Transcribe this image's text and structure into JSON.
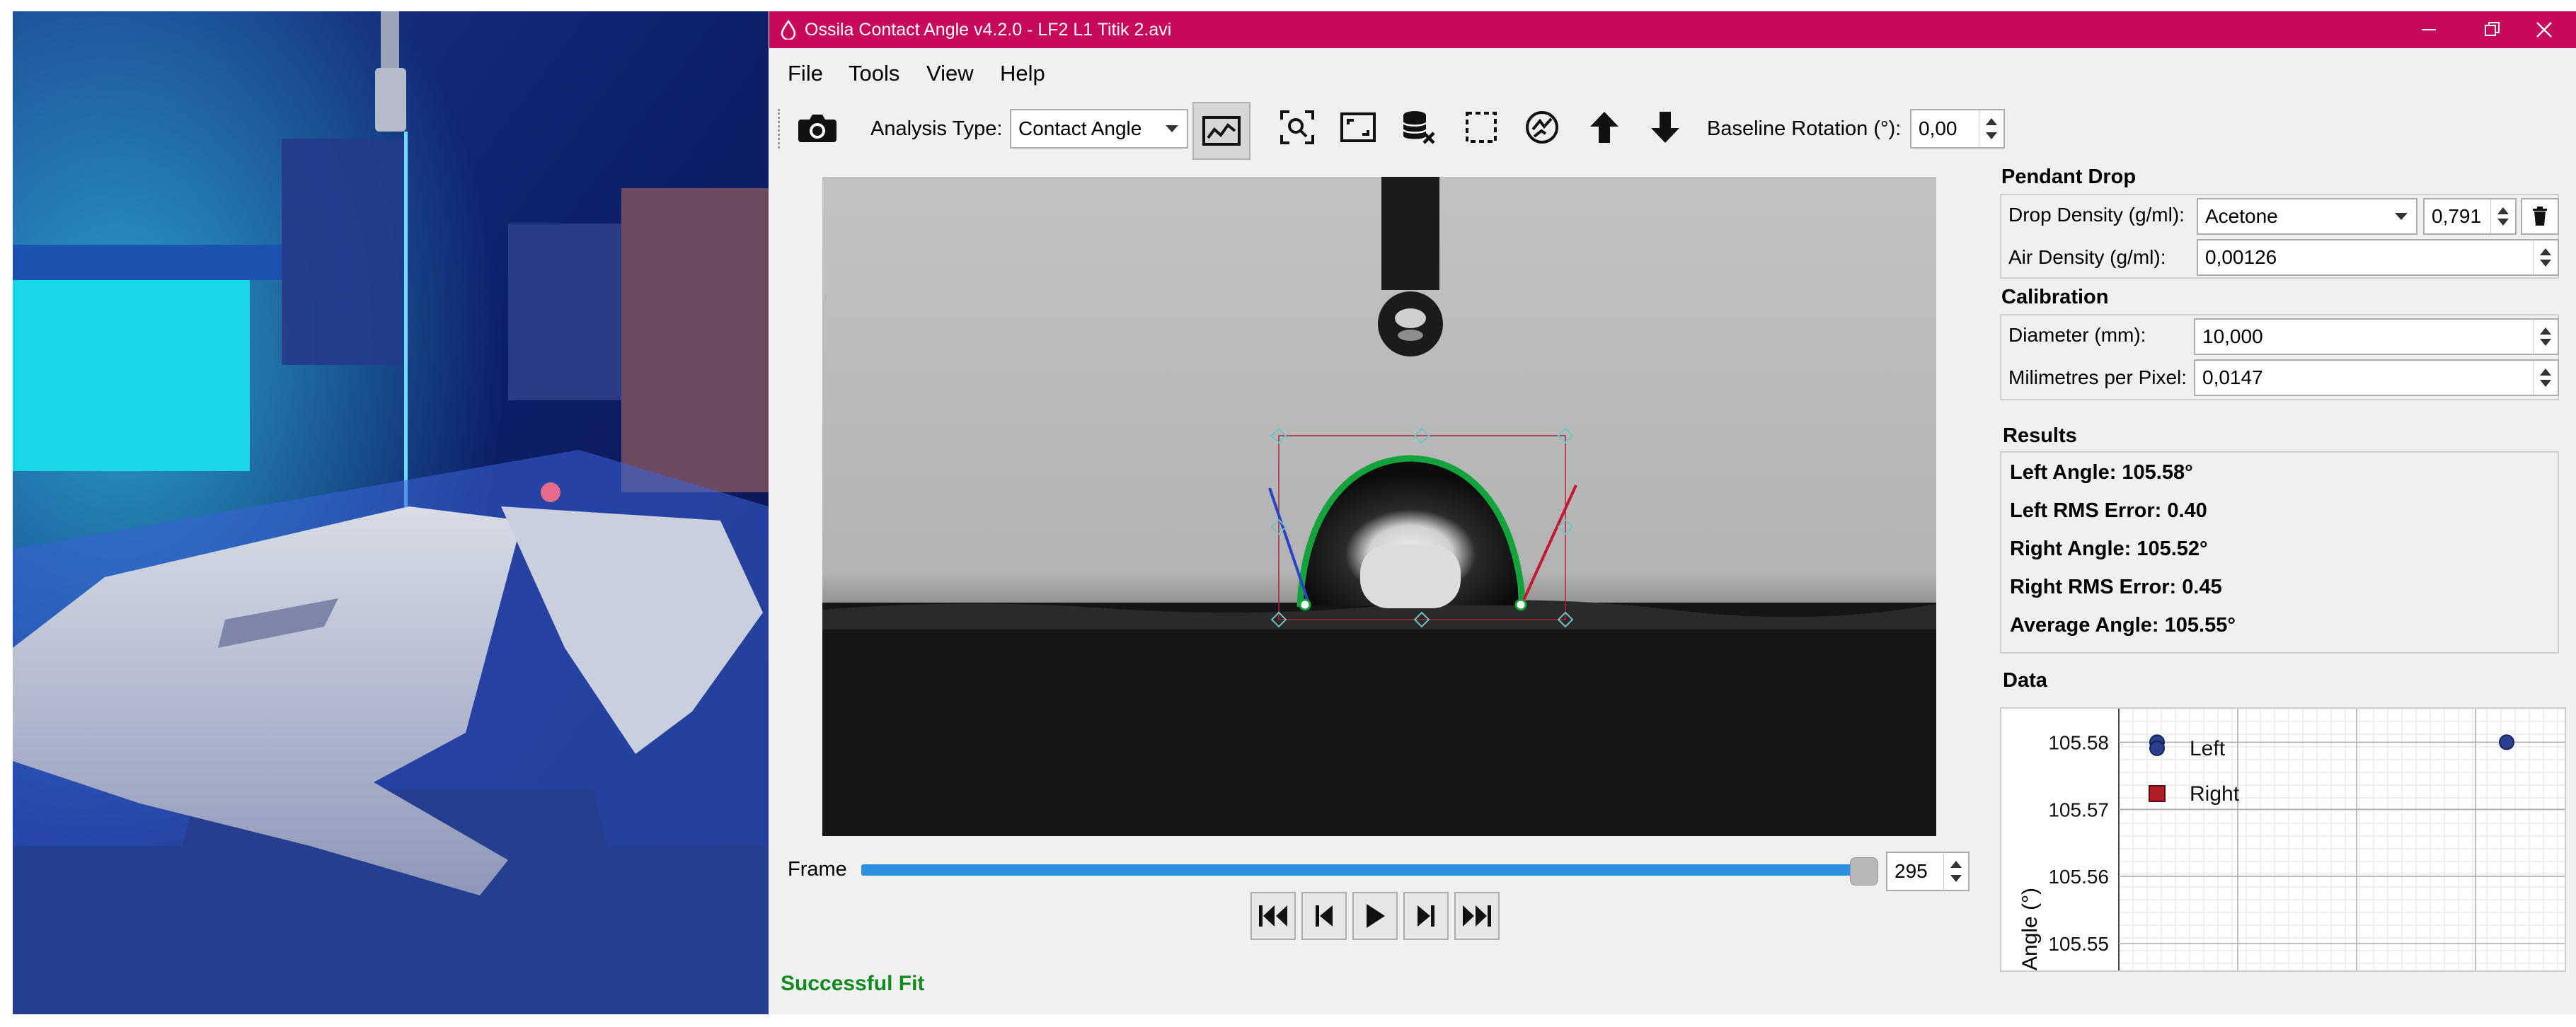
{
  "window": {
    "title": "Ossila Contact Angle v4.2.0 - LF2 L1 Titik 2.avi",
    "accent_color": "#c8085a",
    "controls": [
      "minimize-icon",
      "restore-icon",
      "close-icon"
    ]
  },
  "menu": [
    "File",
    "Tools",
    "View",
    "Help"
  ],
  "toolbar": {
    "analysis_type_label": "Analysis Type:",
    "analysis_type_value": "Contact Angle",
    "baseline_rotation_label": "Baseline Rotation (°):",
    "baseline_rotation_value": "0,00",
    "icons": [
      "camera-icon",
      "fit-line-icon",
      "zoom-search-icon",
      "crop-frame-icon",
      "clear-data-icon",
      "select-region-icon",
      "auto-fit-icon",
      "arrow-up-icon",
      "arrow-down-icon"
    ]
  },
  "playback": {
    "frame_label": "Frame",
    "frame_value": "295",
    "slider_fraction": 1.0,
    "buttons": [
      "skip-to-start-icon",
      "step-back-icon",
      "play-icon",
      "step-forward-icon",
      "skip-to-end-icon"
    ]
  },
  "status": "Successful Fit",
  "pendant_drop": {
    "title": "Pendant Drop",
    "drop_density_label": "Drop Density (g/ml):",
    "liquid": "Acetone",
    "drop_density_value": "0,791",
    "air_density_label": "Air Density (g/ml):",
    "air_density_value": "0,00126"
  },
  "calibration": {
    "title": "Calibration",
    "diameter_label": "Diameter (mm):",
    "diameter_value": "10,000",
    "mpp_label": "Milimetres per Pixel:",
    "mpp_value": "0,0147"
  },
  "results": {
    "title": "Results",
    "lines": [
      "Left Angle: 105.58°",
      "Left RMS Error: 0.40",
      "Right Angle: 105.52°",
      "Right RMS Error: 0.45",
      "Average Angle: 105.55°"
    ]
  },
  "data_section": {
    "title": "Data",
    "chart_data": {
      "type": "scatter",
      "ylabel": "Angle (°)",
      "yticks": [
        "105.58",
        "105.57",
        "105.56",
        "105.55"
      ],
      "yrange_visible": [
        105.546,
        105.585
      ],
      "legend": [
        {
          "name": "Left",
          "marker": "circle",
          "color": "#2b3f8f"
        },
        {
          "name": "Right",
          "marker": "square",
          "color": "#b01e23"
        }
      ],
      "series": [
        {
          "name": "Left",
          "values": [
            105.58,
            105.58
          ]
        }
      ],
      "grid": true
    }
  }
}
